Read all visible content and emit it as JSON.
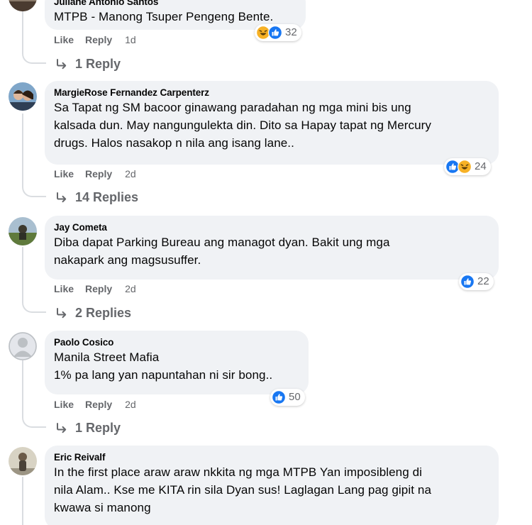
{
  "comments": [
    {
      "author": "Juliane Antonio Santos",
      "lines": [
        "MTPB - Manong Tsuper Pengeng Bente."
      ],
      "actions": {
        "like": "Like",
        "reply": "Reply",
        "time": "1d"
      },
      "reactions": {
        "icons": [
          "haha-icon",
          "like-icon"
        ],
        "count": "32"
      },
      "replies": "1 Reply"
    },
    {
      "author": "MargieRose Fernandez Carpenterz",
      "lines": [
        "Sa Tapat ng SM bacoor ginawang paradahan ng mga mini bis ung",
        "kalsada dun. May nangungulekta din. Dito sa Hapay tapat ng Mercury",
        "drugs. Halos nasakop n nila ang isang lane.."
      ],
      "actions": {
        "like": "Like",
        "reply": "Reply",
        "time": "2d"
      },
      "reactions": {
        "icons": [
          "like-icon",
          "haha-icon"
        ],
        "count": "24"
      },
      "replies": "14 Replies"
    },
    {
      "author": "Jay Cometa",
      "lines": [
        "Diba dapat Parking Bureau ang managot dyan. Bakit ung mga",
        "nakapark ang magsusuffer."
      ],
      "actions": {
        "like": "Like",
        "reply": "Reply",
        "time": "2d"
      },
      "reactions": {
        "icons": [
          "like-icon"
        ],
        "count": "22"
      },
      "replies": "2 Replies"
    },
    {
      "author": "Paolo Cosico",
      "lines": [
        "Manila Street Mafia",
        "1% pa lang yan napuntahan ni sir bong.."
      ],
      "actions": {
        "like": "Like",
        "reply": "Reply",
        "time": "2d"
      },
      "reactions": {
        "icons": [
          "like-icon"
        ],
        "count": "50"
      },
      "replies": "1 Reply"
    },
    {
      "author": "Eric Reivalf",
      "lines": [
        "In the first place araw araw nkkita ng mga MTPB Yan imposibleng di",
        "nila Alam.. Kse me KITA rin sila Dyan sus! Laglagan Lang pag gipit na",
        "kwawa si manong"
      ]
    }
  ],
  "colors": {
    "bubble": "#f0f2f5",
    "meta": "#65676b",
    "like_blue": "#1877f2",
    "haha_yellow": "#f7b125"
  }
}
